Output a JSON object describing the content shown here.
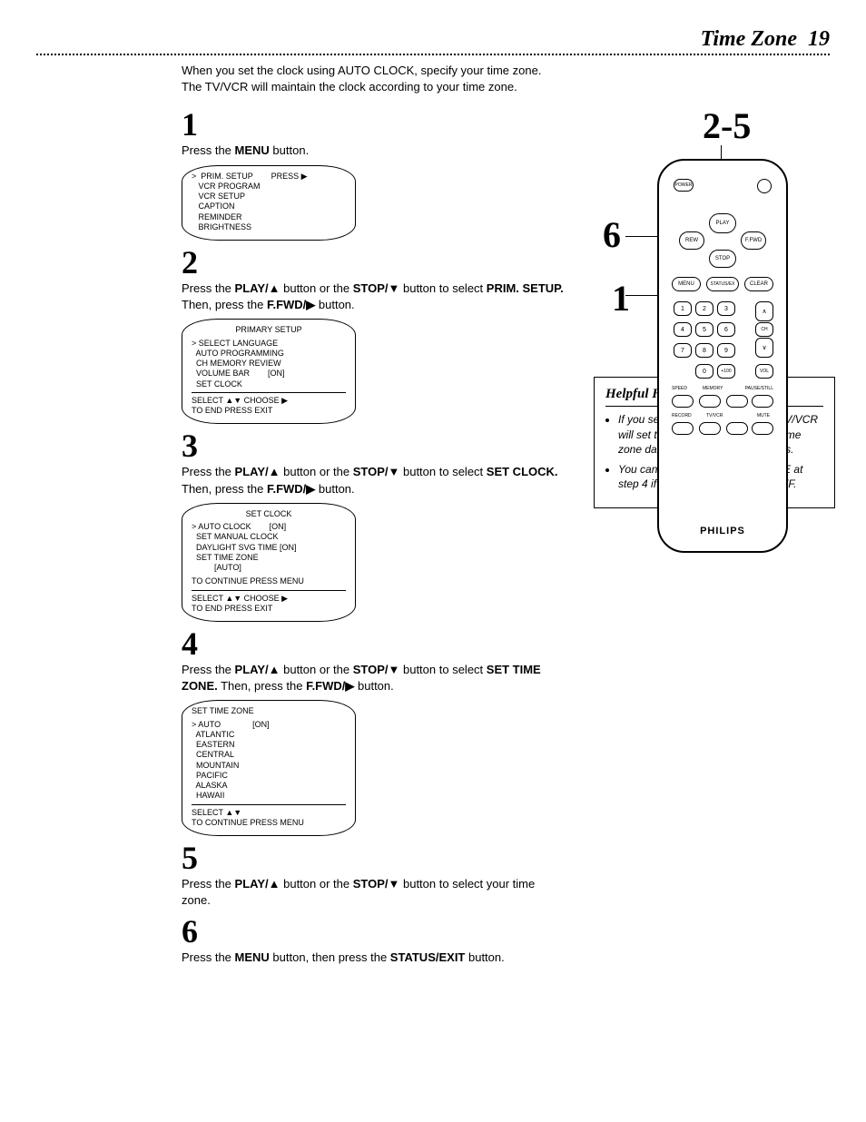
{
  "header": {
    "title": "Time Zone",
    "page_number": "19"
  },
  "intro_line1": "When you set the clock using AUTO CLOCK, specify your time zone.",
  "intro_line2": "The TV/VCR will maintain the clock according to your time zone.",
  "steps": {
    "s1": {
      "num": "1",
      "text_a": "Press the ",
      "text_b": "MENU",
      "text_c": " button.",
      "screen": {
        "lines": [
          ">  PRIM. SETUP        PRESS ▶",
          "   VCR PROGRAM",
          "   VCR SETUP",
          "   CAPTION",
          "   REMINDER",
          "   BRIGHTNESS"
        ]
      }
    },
    "s2": {
      "num": "2",
      "text": "Press the PLAY/▲ button or the STOP/▼ button to select PRIM. SETUP. Then, press the F.FWD/▶ button.",
      "screen": {
        "title": "PRIMARY SETUP",
        "lines": [
          "> SELECT LANGUAGE",
          "  AUTO PROGRAMMING",
          "  CH MEMORY REVIEW",
          "  VOLUME BAR        [ON]",
          "  SET CLOCK"
        ],
        "footer1": "SELECT ▲▼ CHOOSE ▶",
        "footer2": "TO END PRESS EXIT"
      }
    },
    "s3": {
      "num": "3",
      "text": "Press the PLAY/▲ button or the STOP/▼ button to select SET CLOCK. Then, press the F.FWD/▶ button.",
      "screen": {
        "title": "SET CLOCK",
        "lines": [
          "> AUTO CLOCK        [ON]",
          "  SET MANUAL CLOCK",
          "  DAYLIGHT SVG TIME [ON]",
          "  SET TIME ZONE",
          "          [AUTO]"
        ],
        "mid": "TO CONTINUE PRESS MENU",
        "footer1": "SELECT ▲▼ CHOOSE ▶",
        "footer2": "TO END PRESS EXIT"
      }
    },
    "s4": {
      "num": "4",
      "text": "Press the PLAY/▲ button or the STOP/▼ button to select SET TIME ZONE. Then, press the F.FWD/▶ button.",
      "screen": {
        "title": "SET TIME ZONE",
        "lines": [
          "> AUTO              [ON]",
          "  ATLANTIC",
          "  EASTERN",
          "  CENTRAL",
          "  MOUNTAIN",
          "  PACIFIC",
          "  ALASKA",
          "  HAWAII"
        ],
        "footer1": "SELECT ▲▼",
        "footer2": "TO CONTINUE PRESS MENU"
      }
    },
    "s5": {
      "num": "5",
      "text": "Press the PLAY/▲ button or the STOP/▼ button to select your time zone."
    },
    "s6": {
      "num": "6",
      "text": "Press the MENU button, then press the STATUS/EXIT button."
    }
  },
  "remote": {
    "callout_25": "2-5",
    "callout_6": "6",
    "callout_1": "1",
    "brand": "PHILIPS",
    "btn_play": "PLAY",
    "btn_rew": "REW",
    "btn_ffwd": "F.FWD",
    "btn_stop": "STOP",
    "btn_menu": "MENU",
    "btn_status": "STATUS/EX",
    "btn_clear": "CLEAR",
    "label_speed": "SPEED",
    "label_memory": "MEMORY",
    "label_pausestill": "PAUSE/STILL",
    "label_record": "RECORD",
    "label_tvvcr": "TV/VCR",
    "label_100": "+100",
    "label_mute": "MUTE",
    "label_power": "POWER",
    "label_chan": "CHANNEL",
    "label_ch_up": "∧",
    "label_ch_dn": "∨",
    "label_vol_up": "∧",
    "label_vol_dn": "∨",
    "digits": [
      "1",
      "2",
      "3",
      "4",
      "5",
      "6",
      "7",
      "8",
      "9",
      "0"
    ]
  },
  "hints": {
    "title": "Helpful Hints",
    "items": [
      "If you select AUTO at step 5, the TV/VCR will set the clock according to the time zone data of the PBS station it finds.",
      "You cannot select SET TIME ZONE at step 4 if AUTO CLOCK is set to OFF."
    ]
  }
}
